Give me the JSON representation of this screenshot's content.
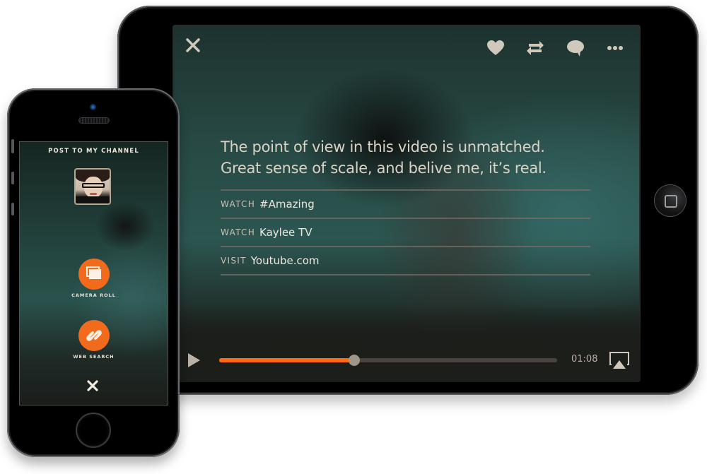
{
  "tablet": {
    "toolbar": {
      "close_icon": "close-icon",
      "actions": [
        {
          "name": "like",
          "icon": "heart-icon"
        },
        {
          "name": "repost",
          "icon": "repost-icon"
        },
        {
          "name": "comment",
          "icon": "comment-icon"
        },
        {
          "name": "more",
          "icon": "more-icon"
        }
      ]
    },
    "comment_text": "The point of view in this video is unmatched. Great sense of scale, and belive me, it’s real.",
    "links": [
      {
        "verb": "WATCH",
        "target": "#Amazing"
      },
      {
        "verb": "WATCH",
        "target": "Kaylee TV"
      },
      {
        "verb": "VISIT",
        "target": "Youtube.com"
      }
    ],
    "player": {
      "play_icon": "play-icon",
      "progress_percent": 40,
      "elapsed_time": "01:08",
      "airplay_icon": "airplay-icon"
    },
    "colors": {
      "accent": "#ff6a13",
      "icon": "#cfc8bb",
      "track": "#4a433f"
    }
  },
  "phone": {
    "title": "POST TO MY CHANNEL",
    "avatar": "user-avatar",
    "actions": [
      {
        "label": "CAMERA ROLL",
        "icon": "camera-roll-icon"
      },
      {
        "label": "WEB SEARCH",
        "icon": "link-icon"
      }
    ],
    "close_icon": "close-icon",
    "colors": {
      "accent": "#f26b1d"
    }
  }
}
